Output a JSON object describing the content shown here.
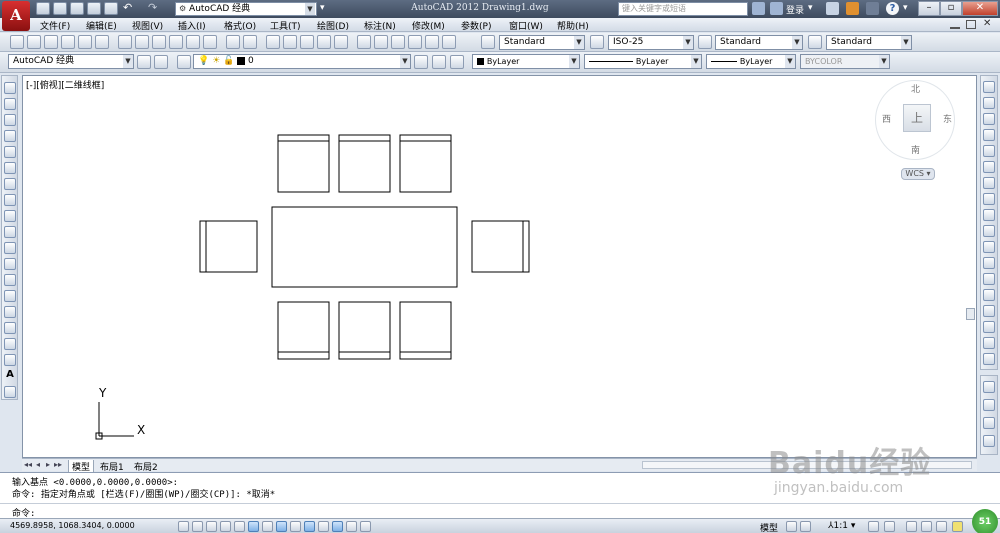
{
  "title_bar": {
    "app_logo": "A",
    "workspace": "AutoCAD 经典",
    "window_title": "AutoCAD 2012   Drawing1.dwg",
    "search_placeholder": "键入关键字或短语",
    "login": "登录"
  },
  "menu": [
    "文件(F)",
    "编辑(E)",
    "视图(V)",
    "插入(I)",
    "格式(O)",
    "工具(T)",
    "绘图(D)",
    "标注(N)",
    "修改(M)",
    "参数(P)",
    "窗口(W)",
    "帮助(H)"
  ],
  "styles": {
    "text_style": "Standard",
    "dim_style": "ISO-25",
    "table_style": "Standard",
    "multileader_style": "Standard"
  },
  "properties": {
    "workspace": "AutoCAD 经典",
    "layer": "0",
    "color": "ByLayer",
    "linetype": "ByLayer",
    "lineweight": "ByLayer",
    "plot_style": "BYCOLOR"
  },
  "viewport_label": "[-][俯视][二维线框]",
  "viewcube": {
    "north": "北",
    "south": "南",
    "east": "东",
    "west": "西",
    "face": "上",
    "wcs": "WCS"
  },
  "ucs": {
    "x_label": "X",
    "y_label": "Y"
  },
  "tabs": [
    "模型",
    "布局1",
    "布局2"
  ],
  "command": {
    "history": [
      "输入基点 <0.0000,0.0000,0.0000>:",
      "命令: 指定对角点或 [栏选(F)/圈围(WP)/圈交(CP)]: *取消*"
    ],
    "prompt": "命令:"
  },
  "status": {
    "coordinates": "4569.8958, 1068.3404, 0.0000",
    "model": "模型",
    "scale": "1:1",
    "badge": "51"
  },
  "watermark": {
    "brand": "Baidu经验",
    "url": "jingyan.baidu.com"
  },
  "colors": {
    "accent_blue": "#4f80b8",
    "logo_red": "#c42020"
  }
}
